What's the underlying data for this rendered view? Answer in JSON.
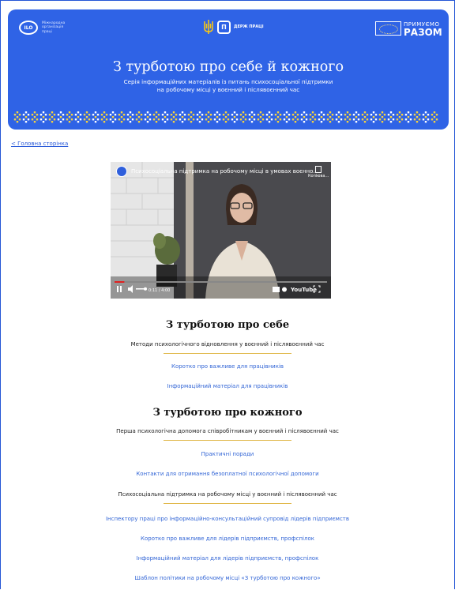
{
  "banner": {
    "ilo_text": "Міжнародна організація праці",
    "ilo_mark": "ILO",
    "dp_mark": "П",
    "dp_text": "ДЕРЖ ПРАЦІ",
    "eu_line1": "ПРИМУЄМО",
    "eu_line2": "РАЗОМ",
    "title": "З турботою про себе й кожного",
    "subtitle_line1": "Серія інформаційних матеріалів із питань психосоціальної підтримки",
    "subtitle_line2": "на робочому місці у воєнний і післявоєнний час",
    "background_color": "#2f63e6"
  },
  "breadcrumb": "< Головна сторінка",
  "video": {
    "title": "Психосоціальна підтримка на робочому місці в умовах воєнно...",
    "copy_label": "Копіюва...",
    "time": "0:11 / 4:00",
    "platform": "YouTube",
    "progress": 0.046
  },
  "section_self": {
    "title": "З турботою про себе",
    "subtitle": "Методи психологічного відновлення у воєнний і післявоєнний час",
    "links": [
      "Коротко про важливе для працівників",
      "Інформаційний матеріал для працівників"
    ]
  },
  "section_others": {
    "title": "З турботою про кожного",
    "subtitle": "Перша психологічна допомога співробітникам у воєнний і післявоєнний час",
    "links": [
      "Практичні поради",
      "Контакти для отримання безоплатної психологічної допомоги"
    ],
    "subheading2": "Психосоціальна підтримка на робочому місці у воєнний і післявоєнний час",
    "links2": [
      "Інспектору праці про інформаційно-консультаційний супровід лідерів підприємств",
      "Коротко про важливе для лідерів підприємств, профспілок",
      "Інформаційний матеріал для лідерів підприємств, профспілок",
      "Шаблон політики на робочому місці «З турботою про кожного»"
    ]
  },
  "colors": {
    "accent_blue": "#2f63e6",
    "link": "#3366d6",
    "divider_gold": "#e0b84a"
  }
}
